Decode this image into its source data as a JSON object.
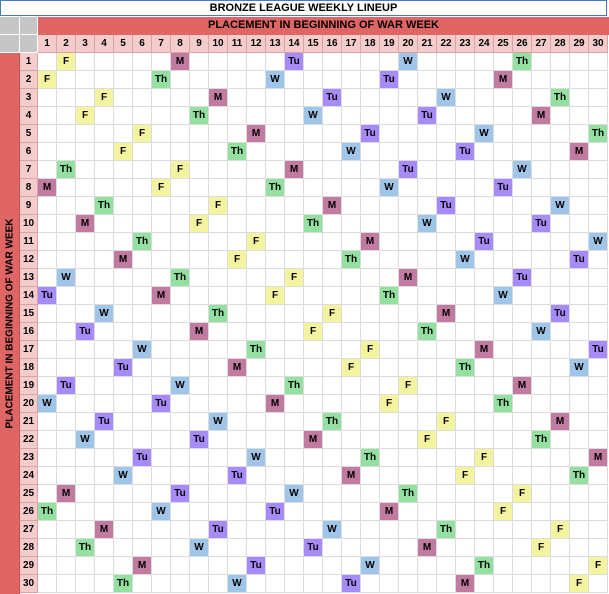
{
  "title": "BRONZE LEAGUE WEEKLY LINEUP",
  "top_header": "PLACEMENT IN BEGINNING OF WAR WEEK",
  "side_header": "PLACEMENT IN BEGINNING OF WAR WEEK",
  "columns": [
    "1",
    "2",
    "3",
    "4",
    "5",
    "6",
    "7",
    "8",
    "9",
    "10",
    "11",
    "12",
    "13",
    "14",
    "15",
    "16",
    "17",
    "18",
    "19",
    "20",
    "21",
    "22",
    "23",
    "24",
    "25",
    "26",
    "27",
    "28",
    "29",
    "30"
  ],
  "rows": [
    "1",
    "2",
    "3",
    "4",
    "5",
    "6",
    "7",
    "8",
    "9",
    "10",
    "11",
    "12",
    "13",
    "14",
    "15",
    "16",
    "17",
    "18",
    "19",
    "20",
    "21",
    "22",
    "23",
    "24",
    "25",
    "26",
    "27",
    "28",
    "29",
    "30"
  ],
  "day_colors": {
    "M": "#c27ba0",
    "Tu": "#a78bfa",
    "W": "#9fc5e8",
    "Th": "#93e0a0",
    "F": "#f3f3a0"
  },
  "grid": [
    [
      [
        "2",
        "F"
      ],
      [
        "8",
        "M"
      ],
      [
        "14",
        "Tu"
      ],
      [
        "20",
        "W"
      ],
      [
        "26",
        "Th"
      ]
    ],
    [
      [
        "1",
        "F"
      ],
      [
        "7",
        "Th"
      ],
      [
        "13",
        "W"
      ],
      [
        "19",
        "Tu"
      ],
      [
        "25",
        "M"
      ]
    ],
    [
      [
        "4",
        "F"
      ],
      [
        "10",
        "M"
      ],
      [
        "16",
        "Tu"
      ],
      [
        "22",
        "W"
      ],
      [
        "28",
        "Th"
      ]
    ],
    [
      [
        "3",
        "F"
      ],
      [
        "9",
        "Th"
      ],
      [
        "15",
        "W"
      ],
      [
        "21",
        "Tu"
      ],
      [
        "27",
        "M"
      ]
    ],
    [
      [
        "6",
        "F"
      ],
      [
        "12",
        "M"
      ],
      [
        "18",
        "Tu"
      ],
      [
        "24",
        "W"
      ],
      [
        "30",
        "Th"
      ]
    ],
    [
      [
        "5",
        "F"
      ],
      [
        "11",
        "Th"
      ],
      [
        "17",
        "W"
      ],
      [
        "23",
        "Tu"
      ],
      [
        "29",
        "M"
      ]
    ],
    [
      [
        "2",
        "Th"
      ],
      [
        "8",
        "F"
      ],
      [
        "14",
        "M"
      ],
      [
        "20",
        "Tu"
      ],
      [
        "26",
        "W"
      ]
    ],
    [
      [
        "1",
        "M"
      ],
      [
        "7",
        "F"
      ],
      [
        "13",
        "Th"
      ],
      [
        "19",
        "W"
      ],
      [
        "25",
        "Tu"
      ]
    ],
    [
      [
        "4",
        "Th"
      ],
      [
        "10",
        "F"
      ],
      [
        "16",
        "M"
      ],
      [
        "22",
        "Tu"
      ],
      [
        "28",
        "W"
      ]
    ],
    [
      [
        "3",
        "M"
      ],
      [
        "9",
        "F"
      ],
      [
        "15",
        "Th"
      ],
      [
        "21",
        "W"
      ],
      [
        "27",
        "Tu"
      ]
    ],
    [
      [
        "6",
        "Th"
      ],
      [
        "12",
        "F"
      ],
      [
        "18",
        "M"
      ],
      [
        "24",
        "Tu"
      ],
      [
        "30",
        "W"
      ]
    ],
    [
      [
        "5",
        "M"
      ],
      [
        "11",
        "F"
      ],
      [
        "17",
        "Th"
      ],
      [
        "23",
        "W"
      ],
      [
        "29",
        "Tu"
      ]
    ],
    [
      [
        "2",
        "W"
      ],
      [
        "8",
        "Th"
      ],
      [
        "14",
        "F"
      ],
      [
        "20",
        "M"
      ],
      [
        "26",
        "Tu"
      ]
    ],
    [
      [
        "1",
        "Tu"
      ],
      [
        "7",
        "M"
      ],
      [
        "13",
        "F"
      ],
      [
        "19",
        "Th"
      ],
      [
        "25",
        "W"
      ]
    ],
    [
      [
        "4",
        "W"
      ],
      [
        "10",
        "Th"
      ],
      [
        "16",
        "F"
      ],
      [
        "22",
        "M"
      ],
      [
        "28",
        "Tu"
      ]
    ],
    [
      [
        "3",
        "Tu"
      ],
      [
        "9",
        "M"
      ],
      [
        "15",
        "F"
      ],
      [
        "21",
        "Th"
      ],
      [
        "27",
        "W"
      ]
    ],
    [
      [
        "6",
        "W"
      ],
      [
        "12",
        "Th"
      ],
      [
        "18",
        "F"
      ],
      [
        "24",
        "M"
      ],
      [
        "30",
        "Tu"
      ]
    ],
    [
      [
        "5",
        "Tu"
      ],
      [
        "11",
        "M"
      ],
      [
        "17",
        "F"
      ],
      [
        "23",
        "Th"
      ],
      [
        "29",
        "W"
      ]
    ],
    [
      [
        "2",
        "Tu"
      ],
      [
        "8",
        "W"
      ],
      [
        "14",
        "Th"
      ],
      [
        "20",
        "F"
      ],
      [
        "26",
        "M"
      ]
    ],
    [
      [
        "1",
        "W"
      ],
      [
        "7",
        "Tu"
      ],
      [
        "13",
        "M"
      ],
      [
        "19",
        "F"
      ],
      [
        "25",
        "Th"
      ]
    ],
    [
      [
        "4",
        "Tu"
      ],
      [
        "10",
        "W"
      ],
      [
        "16",
        "Th"
      ],
      [
        "22",
        "F"
      ],
      [
        "28",
        "M"
      ]
    ],
    [
      [
        "3",
        "W"
      ],
      [
        "9",
        "Tu"
      ],
      [
        "15",
        "M"
      ],
      [
        "21",
        "F"
      ],
      [
        "27",
        "Th"
      ]
    ],
    [
      [
        "6",
        "Tu"
      ],
      [
        "12",
        "W"
      ],
      [
        "18",
        "Th"
      ],
      [
        "24",
        "F"
      ],
      [
        "30",
        "M"
      ]
    ],
    [
      [
        "5",
        "W"
      ],
      [
        "11",
        "Tu"
      ],
      [
        "17",
        "M"
      ],
      [
        "23",
        "F"
      ],
      [
        "29",
        "Th"
      ]
    ],
    [
      [
        "2",
        "M"
      ],
      [
        "8",
        "Tu"
      ],
      [
        "14",
        "W"
      ],
      [
        "20",
        "Th"
      ],
      [
        "26",
        "F"
      ]
    ],
    [
      [
        "1",
        "Th"
      ],
      [
        "7",
        "W"
      ],
      [
        "13",
        "Tu"
      ],
      [
        "19",
        "M"
      ],
      [
        "25",
        "F"
      ]
    ],
    [
      [
        "4",
        "M"
      ],
      [
        "10",
        "Tu"
      ],
      [
        "16",
        "W"
      ],
      [
        "22",
        "Th"
      ],
      [
        "28",
        "F"
      ]
    ],
    [
      [
        "3",
        "Th"
      ],
      [
        "9",
        "W"
      ],
      [
        "15",
        "Tu"
      ],
      [
        "21",
        "M"
      ],
      [
        "27",
        "F"
      ]
    ],
    [
      [
        "6",
        "M"
      ],
      [
        "12",
        "Tu"
      ],
      [
        "18",
        "W"
      ],
      [
        "24",
        "Th"
      ],
      [
        "30",
        "F"
      ]
    ],
    [
      [
        "5",
        "Th"
      ],
      [
        "11",
        "W"
      ],
      [
        "17",
        "Tu"
      ],
      [
        "23",
        "M"
      ],
      [
        "29",
        "F"
      ]
    ]
  ]
}
